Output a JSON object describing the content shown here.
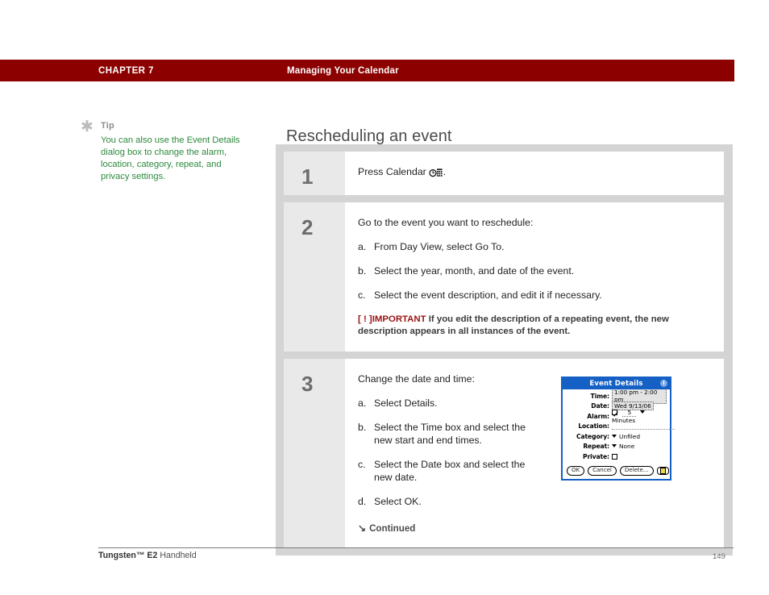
{
  "header": {
    "chapter_label": "CHAPTER 7",
    "chapter_title": "Managing Your Calendar",
    "bar_color": "#8c0000"
  },
  "tip": {
    "icon": "asterisk-icon",
    "label": "Tip",
    "body": "You can also use the Event Details dialog box to change the alarm, location, category, repeat, and privacy settings.",
    "text_color": "#2d8a3e"
  },
  "main": {
    "heading": "Rescheduling an event",
    "steps": [
      {
        "number": "1",
        "lead": "Press Calendar",
        "trailing": ".",
        "icon": "calendar-button-icon"
      },
      {
        "number": "2",
        "lead": "Go to the event you want to reschedule:",
        "items": [
          {
            "marker": "a.",
            "text": "From Day View, select Go To."
          },
          {
            "marker": "b.",
            "text": "Select the year, month, and date of the event."
          },
          {
            "marker": "c.",
            "text": "Select the event description, and edit it if necessary."
          }
        ],
        "important": {
          "bracket": "[ ! ]",
          "tag": "IMPORTANT",
          "text": "If you edit the description of a repeating event, the new description appears in all instances of the event.",
          "color": "#9b1111"
        }
      },
      {
        "number": "3",
        "lead": "Change the date and time:",
        "items": [
          {
            "marker": "a.",
            "text": "Select Details."
          },
          {
            "marker": "b.",
            "text": "Select the Time box and select the new start and end times."
          },
          {
            "marker": "c.",
            "text": "Select the Date box and select the new date."
          },
          {
            "marker": "d.",
            "text": "Select OK."
          }
        ],
        "continued": "Continued",
        "continued_icon": "arrow-down-right-icon"
      }
    ]
  },
  "dialog": {
    "title": "Event Details",
    "info_icon": "info-icon",
    "title_bar_color": "#1560c4",
    "rows": [
      {
        "label": "Time:",
        "value": "1:00 pm - 2:00 pm",
        "kind": "field"
      },
      {
        "label": "Date:",
        "value": "Wed 9/13/06",
        "kind": "field"
      },
      {
        "label": "Alarm:",
        "value": "5",
        "unit": "Minutes",
        "kind": "alarm",
        "checked": true
      },
      {
        "label": "Location:",
        "value": "",
        "kind": "dotted"
      },
      {
        "label": "Category:",
        "value": "Unfiled",
        "kind": "picker"
      },
      {
        "label": "Repeat:",
        "value": "None",
        "kind": "picker"
      },
      {
        "label": "Private:",
        "value": "",
        "kind": "checkbox",
        "checked": false
      }
    ],
    "buttons": [
      {
        "label": "OK",
        "name": "ok-button"
      },
      {
        "label": "Cancel",
        "name": "cancel-button"
      },
      {
        "label": "Delete...",
        "name": "delete-button"
      }
    ],
    "note_button_icon": "note-icon"
  },
  "footer": {
    "product": "Tungsten™ E2",
    "product_suffix": " Handheld",
    "page_number": "149"
  }
}
